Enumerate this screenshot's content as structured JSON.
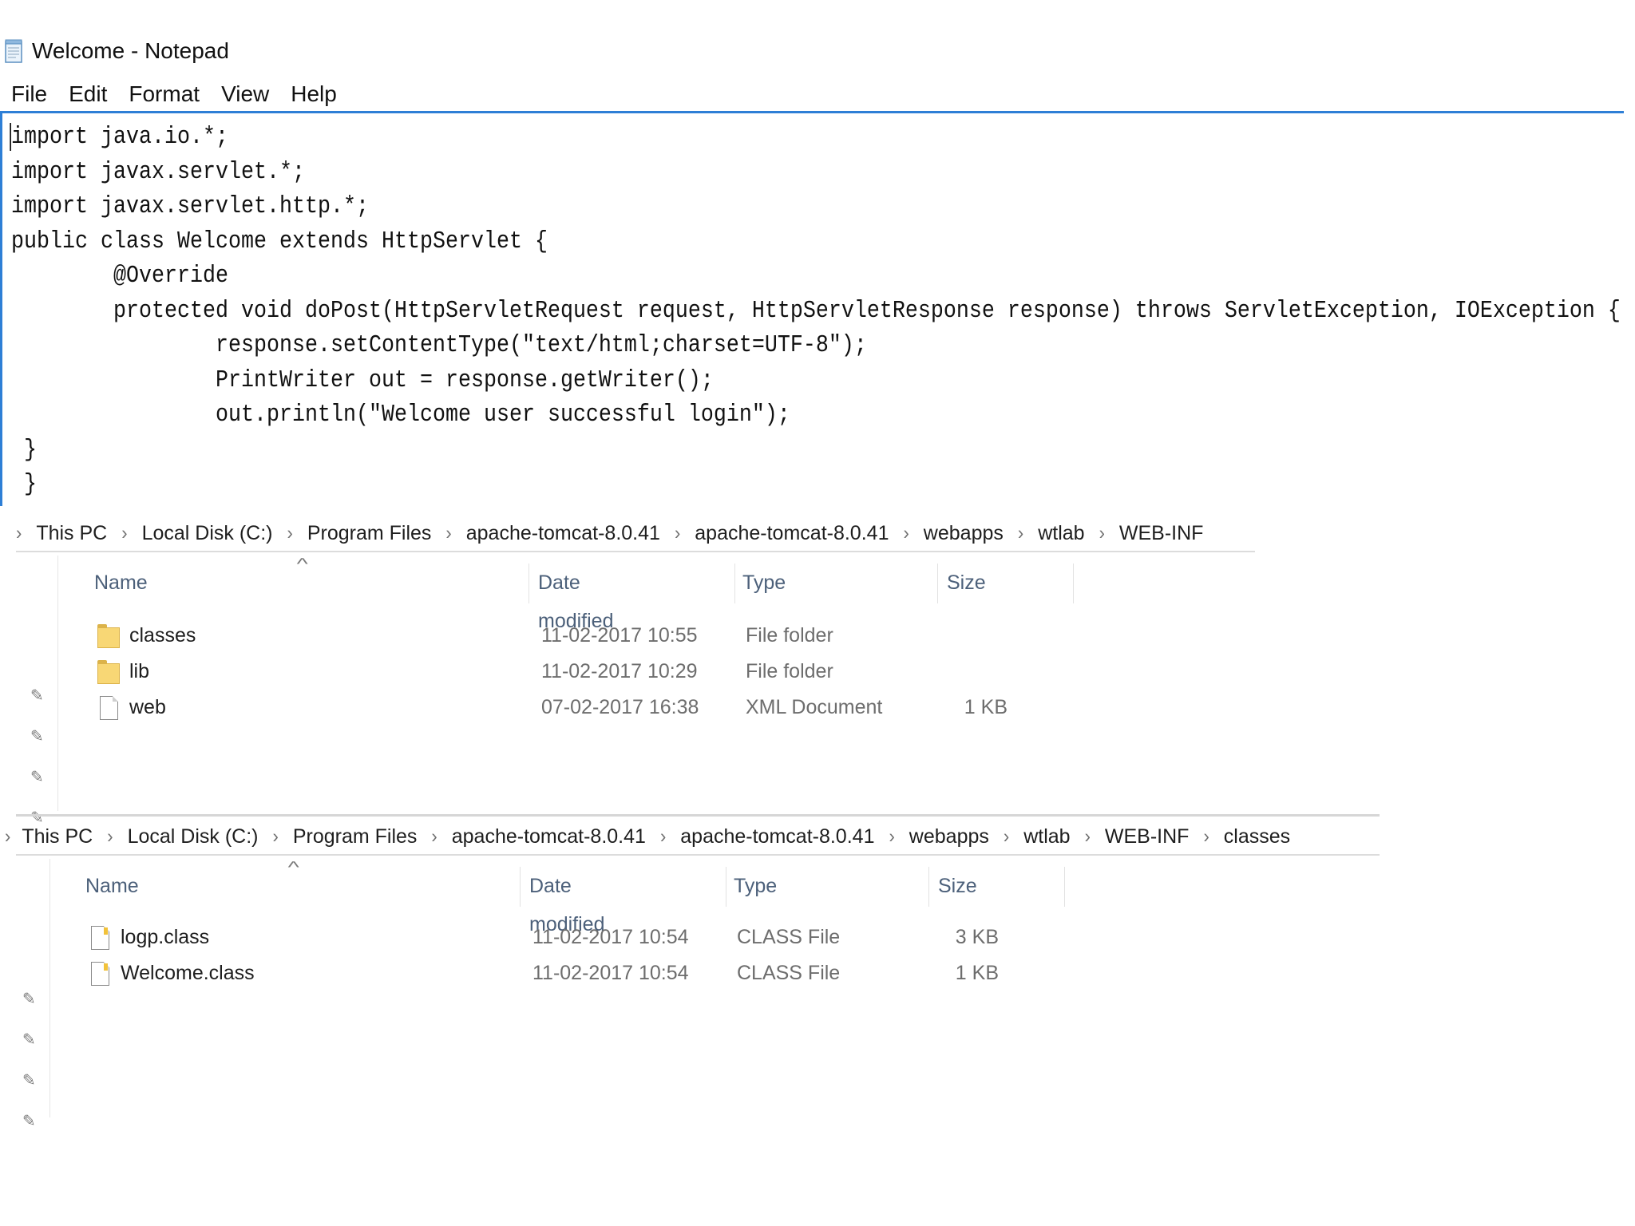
{
  "notepad": {
    "title": "Welcome - Notepad",
    "menu": [
      "File",
      "Edit",
      "Format",
      "View",
      "Help"
    ],
    "code_lines": [
      "import java.io.*;",
      "import javax.servlet.*;",
      "import javax.servlet.http.*;",
      "public class Welcome extends HttpServlet {",
      "        @Override",
      "        protected void doPost(HttpServletRequest request, HttpServletResponse response) throws ServletException, IOException {",
      "                response.setContentType(\"text/html;charset=UTF-8\");",
      "                PrintWriter out = response.getWriter();",
      "                out.println(\"Welcome user successful login\");",
      " }",
      " }"
    ]
  },
  "explorer_panes": [
    {
      "breadcrumb": [
        "This PC",
        "Local Disk (C:)",
        "Program Files",
        "apache-tomcat-8.0.41",
        "apache-tomcat-8.0.41",
        "webapps",
        "wtlab",
        "WEB-INF"
      ],
      "columns": {
        "name": "Name",
        "date": "Date modified",
        "type": "Type",
        "size": "Size"
      },
      "files": [
        {
          "name": "classes",
          "date": "11-02-2017 10:55",
          "type": "File folder",
          "size": "",
          "icon": "folder-icon"
        },
        {
          "name": "lib",
          "date": "11-02-2017 10:29",
          "type": "File folder",
          "size": "",
          "icon": "folder-icon"
        },
        {
          "name": "web",
          "date": "07-02-2017 16:38",
          "type": "XML Document",
          "size": "1 KB",
          "icon": "document-icon"
        }
      ]
    },
    {
      "breadcrumb": [
        "This PC",
        "Local Disk (C:)",
        "Program Files",
        "apache-tomcat-8.0.41",
        "apache-tomcat-8.0.41",
        "webapps",
        "wtlab",
        "WEB-INF",
        "classes"
      ],
      "columns": {
        "name": "Name",
        "date": "Date modified",
        "type": "Type",
        "size": "Size"
      },
      "files": [
        {
          "name": "logp.class",
          "date": "11-02-2017 10:54",
          "type": "CLASS File",
          "size": "3 KB",
          "icon": "class-file-icon"
        },
        {
          "name": "Welcome.class",
          "date": "11-02-2017 10:54",
          "type": "CLASS File",
          "size": "1 KB",
          "icon": "class-file-icon"
        }
      ]
    }
  ],
  "glyphs": {
    "sep": "›",
    "sort": "^",
    "pin": "✎"
  },
  "colors": {
    "accent": "#2e7fd6",
    "header_text": "#4c607a",
    "folder": "#f8d775"
  }
}
